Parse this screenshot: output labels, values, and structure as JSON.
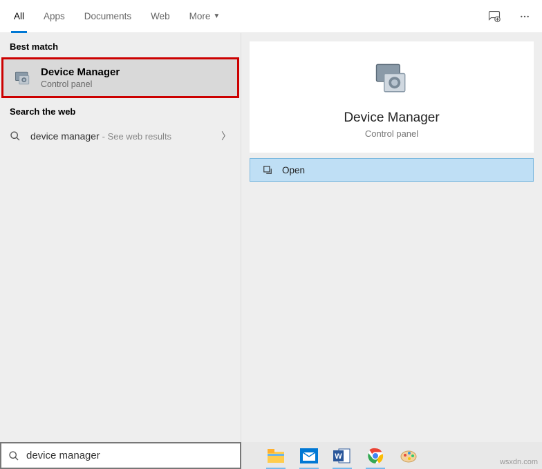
{
  "tabs": {
    "all": "All",
    "apps": "Apps",
    "documents": "Documents",
    "web": "Web",
    "more": "More"
  },
  "sections": {
    "best_match": "Best match",
    "search_web": "Search the web"
  },
  "best_result": {
    "title": "Device Manager",
    "subtitle": "Control panel"
  },
  "web_result": {
    "query": "device manager",
    "hint": "- See web results"
  },
  "preview": {
    "title": "Device Manager",
    "subtitle": "Control panel"
  },
  "actions": {
    "open": "Open"
  },
  "search": {
    "value": "device manager"
  },
  "watermark": "wsxdn.com"
}
